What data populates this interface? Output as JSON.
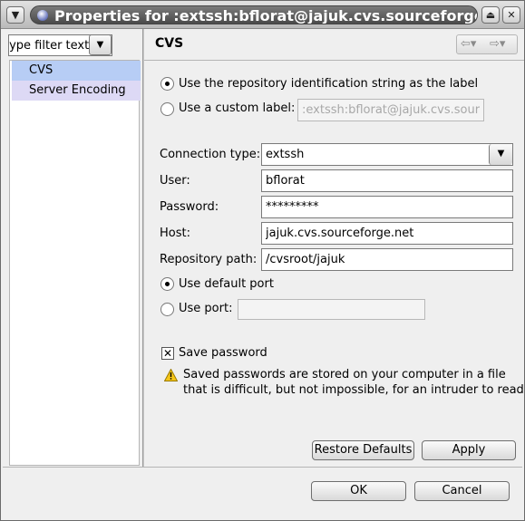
{
  "window": {
    "title": "Properties for :extssh:bflorat@jajuk.cvs.sourceforge.ne",
    "menu_icon": "chevron-down-icon",
    "shade_icon": "shade-icon",
    "close_icon": "close-icon"
  },
  "filter": {
    "value": "type filter text"
  },
  "tree": {
    "items": [
      {
        "label": "CVS",
        "selected": true
      },
      {
        "label": "Server Encoding"
      }
    ]
  },
  "header": {
    "title": "CVS",
    "back_icon": "arrow-left-icon",
    "forward_icon": "arrow-right-icon"
  },
  "label_options": {
    "repo_id": {
      "label": "Use the repository identification string as the label",
      "selected": true
    },
    "custom": {
      "label": "Use a custom label:",
      "value": ":extssh:bflorat@jajuk.cvs.sourceforge.net:/cvsroot/jajuk"
    }
  },
  "connection": {
    "type_label": "Connection type:",
    "type_value": "extssh",
    "user_label": "User:",
    "user_value": "bflorat",
    "password_label": "Password:",
    "password_value": "*********",
    "host_label": "Host:",
    "host_value": "jajuk.cvs.sourceforge.net",
    "path_label": "Repository path:",
    "path_value": "/cvsroot/jajuk"
  },
  "port": {
    "default_label": "Use default port",
    "default_selected": true,
    "custom_label": "Use port:",
    "custom_value": ""
  },
  "save_password": {
    "label": "Save password",
    "checked": true,
    "warning_line1": "Saved passwords are stored on your computer in a file",
    "warning_line2": "that is difficult, but not impossible, for an intruder to read."
  },
  "buttons": {
    "restore_defaults": "Restore Defaults",
    "apply": "Apply",
    "ok": "OK",
    "cancel": "Cancel"
  }
}
